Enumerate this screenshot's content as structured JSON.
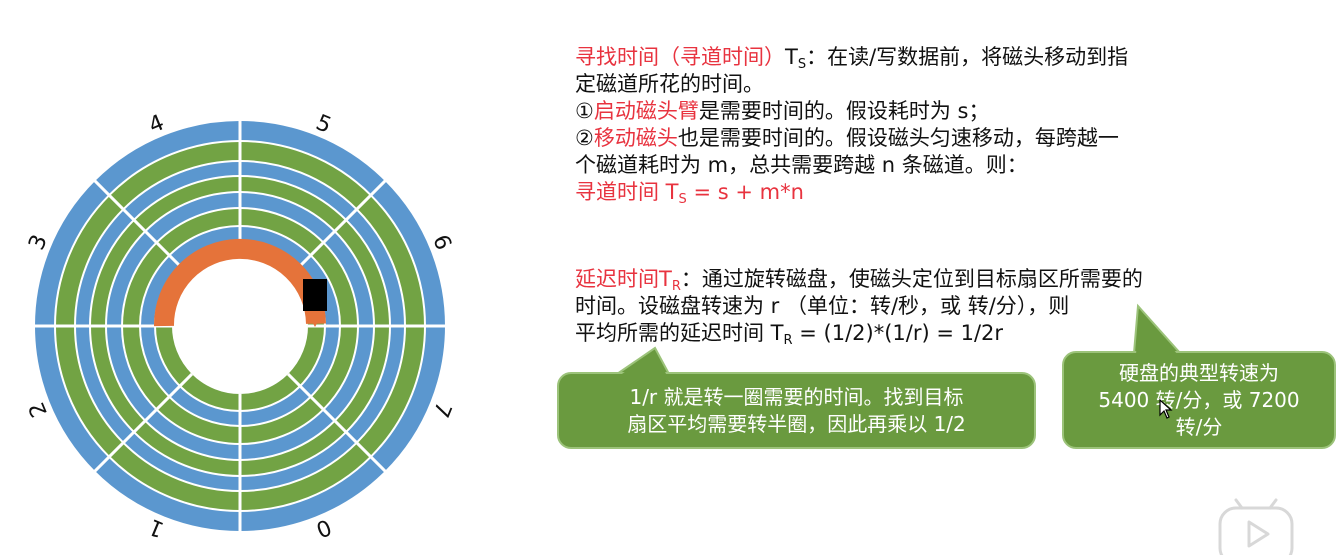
{
  "colors": {
    "track_blue": "#5b97cf",
    "track_green": "#72a344",
    "arc_orange": "#e5733a",
    "highlight_red": "#e8333f",
    "callout_green": "#6a9a3f"
  },
  "disk": {
    "sector_labels": [
      "0",
      "1",
      "2",
      "3",
      "4",
      "5",
      "6",
      "7"
    ],
    "head_icon": "disk-head-icon"
  },
  "seek": {
    "title": "寻找时间（寻道时间）",
    "symbol": "T",
    "symbol_sub": "S",
    "desc": "：在读/写数据前，将磁头移动到指",
    "desc2": "定磁道所花的时间。",
    "item1_num": "①",
    "item1_red": "启动磁头臂",
    "item1_rest": "是需要时间的。假设耗时为 s；",
    "item2_num": "②",
    "item2_red": "移动磁头",
    "item2_rest": "也是需要时间的。假设磁头匀速移动，每跨越一",
    "item2_rest2": "个磁道耗时为 m，总共需要跨越 n 条磁道。则：",
    "formula_prefix": "寻道时间 T",
    "formula_sub": "S",
    "formula_rest": " = s + m*n"
  },
  "rotation": {
    "title": "延迟时间T",
    "title_sub": "R",
    "desc": "：通过旋转磁盘，使磁头定位到目标扇区所需要的",
    "desc2": "时间。设磁盘转速为 r （单位：转/秒，或 转/分），则",
    "formula_prefix": "平均所需的延迟时间 T",
    "formula_sub": "R",
    "formula_rest": " = (1/2)*(1/r) = 1/2r"
  },
  "callouts": {
    "half_turn_line1": "1/r 就是转一圈需要的时间。找到目标",
    "half_turn_line2": "扇区平均需要转半圈，因此再乘以 1/2",
    "speed_line1": "硬盘的典型转速为",
    "speed_line2": "5400 转/分，或 7200",
    "speed_line3": "转/分"
  },
  "icons": {
    "cursor": "mouse-cursor-icon",
    "play": "play-button-icon"
  }
}
